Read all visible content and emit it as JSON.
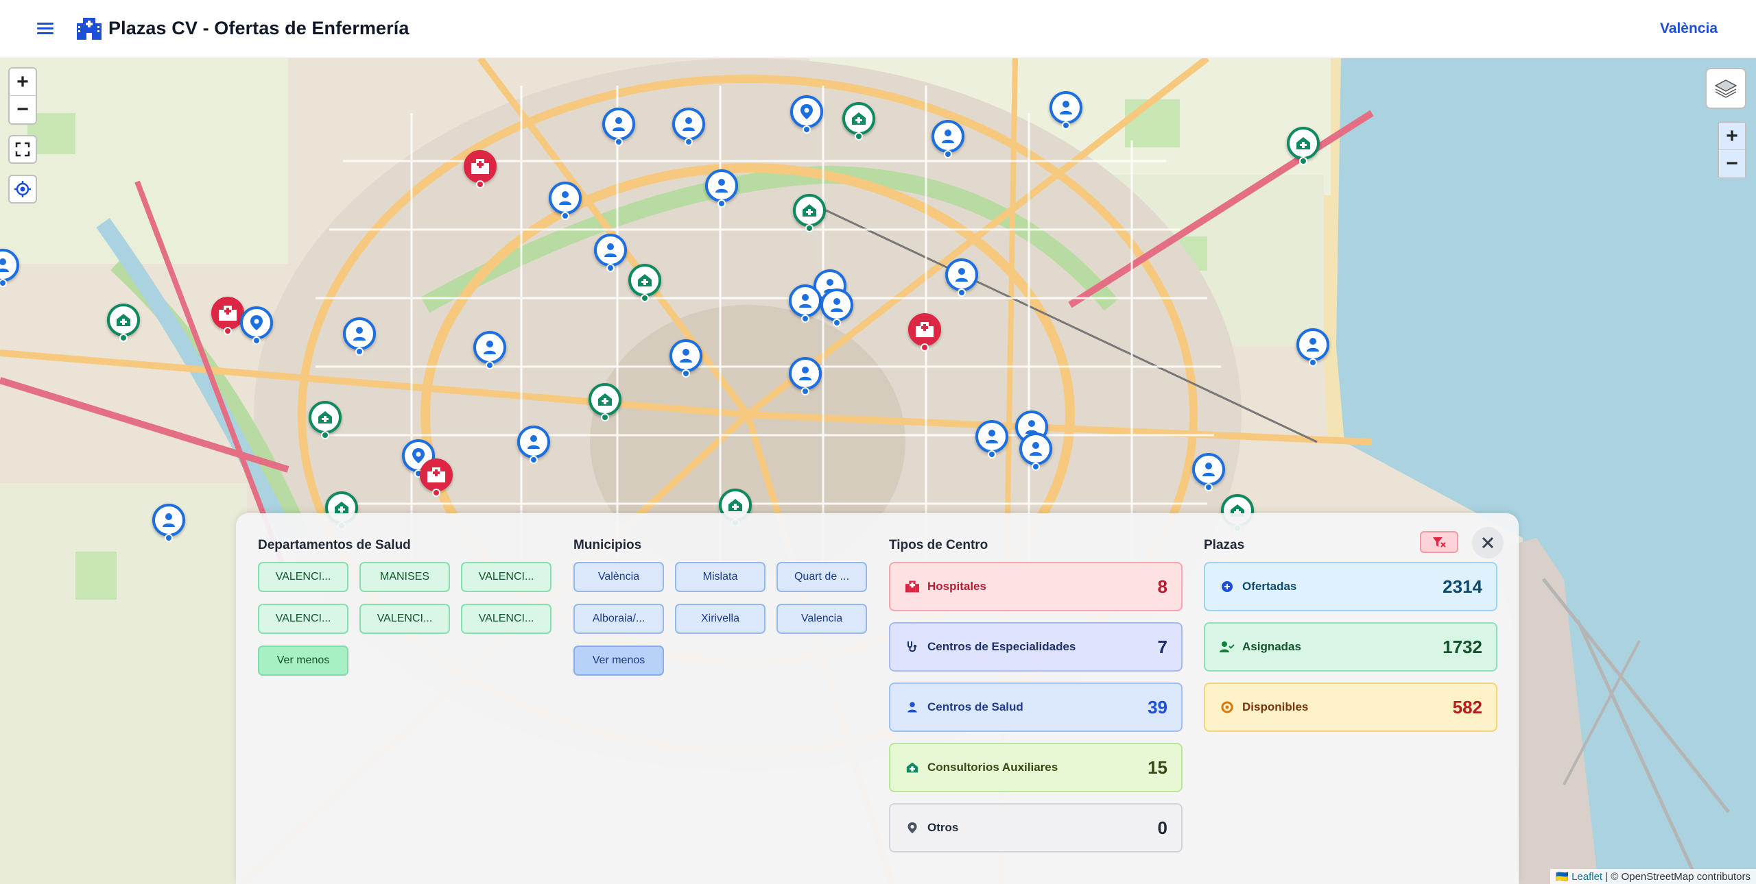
{
  "header": {
    "title": "Plazas CV - Ofertas de Enfermería",
    "city_link": "València",
    "menu_icon": "hamburger-menu-icon",
    "logo_icon": "hospital-building-icon"
  },
  "map": {
    "zoom_in": "+",
    "zoom_out": "−",
    "attribution_leaflet": "Leaflet",
    "attribution_rest": " | © OpenStreetMap contributors",
    "flag": "🇺🇦"
  },
  "panel": {
    "departamentos": {
      "title": "Departamentos de Salud",
      "items": [
        "VALENCI...",
        "MANISES",
        "VALENCI...",
        "VALENCI...",
        "VALENCI...",
        "VALENCI..."
      ],
      "toggle": "Ver menos"
    },
    "municipios": {
      "title": "Municipios",
      "items": [
        "València",
        "Mislata",
        "Quart de ...",
        "Alboraia/...",
        "Xirivella",
        "Valencia"
      ],
      "toggle": "Ver menos"
    },
    "tipos": {
      "title": "Tipos de Centro",
      "items": [
        {
          "label": "Hospitales",
          "count": "8",
          "icon": "hospital-icon"
        },
        {
          "label": "Centros de Especialidades",
          "count": "7",
          "icon": "stethoscope-icon"
        },
        {
          "label": "Centros de Salud",
          "count": "39",
          "icon": "user-doctor-icon"
        },
        {
          "label": "Consultorios Auxiliares",
          "count": "15",
          "icon": "house-medical-icon"
        },
        {
          "label": "Otros",
          "count": "0",
          "icon": "map-pin-icon"
        }
      ]
    },
    "plazas": {
      "title": "Plazas",
      "items": [
        {
          "label": "Ofertadas",
          "count": "2314",
          "icon": "plus-circle-icon"
        },
        {
          "label": "Asignadas",
          "count": "1732",
          "icon": "user-check-icon"
        },
        {
          "label": "Disponibles",
          "count": "582",
          "icon": "circle-dot-icon"
        }
      ]
    }
  },
  "colors": {
    "brand": "#1d4ed8",
    "hospital": "#dc2644",
    "centro_salud": "#1d6fe0",
    "consultorio": "#0f8a5f"
  }
}
